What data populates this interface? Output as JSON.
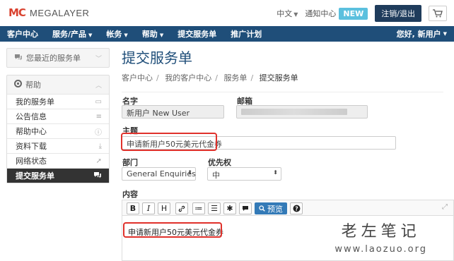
{
  "brand": {
    "name": "MEGALAYER",
    "mark": "MC"
  },
  "header": {
    "language": "中文",
    "notifications": "通知中心",
    "new_badge": "NEW",
    "logout": "注销/退出"
  },
  "nav": {
    "items": [
      {
        "label": "客户中心",
        "dropdown": false
      },
      {
        "label": "服务/产品",
        "dropdown": true
      },
      {
        "label": "帐务",
        "dropdown": true
      },
      {
        "label": "帮助",
        "dropdown": true
      },
      {
        "label": "提交服务单",
        "dropdown": false
      },
      {
        "label": "推广计划",
        "dropdown": false
      }
    ],
    "user": "您好, 新用户"
  },
  "sidebar": {
    "recent_title": "您最近的服务单",
    "help_title": "帮助",
    "items": [
      {
        "label": "我的服务单",
        "icon": "ticket-icon"
      },
      {
        "label": "公告信息",
        "icon": "list-icon"
      },
      {
        "label": "帮助中心",
        "icon": "info-icon"
      },
      {
        "label": "资料下载",
        "icon": "download-icon"
      },
      {
        "label": "网络状态",
        "icon": "rocket-icon"
      },
      {
        "label": "提交服务单",
        "icon": "comments-icon",
        "active": true
      }
    ]
  },
  "main": {
    "title": "提交服务单",
    "breadcrumb": [
      "客户中心",
      "我的客户中心",
      "服务单",
      "提交服务单"
    ],
    "form": {
      "name_label": "名字",
      "name_value": "新用户 New User",
      "email_label": "邮箱",
      "subject_label": "主题",
      "subject_value": "申请新用户50元美元代金券",
      "dept_label": "部门",
      "dept_value": "General Enquiries",
      "priority_label": "优先权",
      "priority_value": "中",
      "content_label": "内容",
      "preview_label": "预览",
      "content_value": "申请新用户50元美元代金券"
    }
  },
  "watermark": {
    "title": "老左笔记",
    "url": "www.laozuo.org"
  },
  "colors": {
    "nav": "#1f4e79",
    "highlight": "#e0312b",
    "brand": "#d9422f",
    "new_badge": "#5bc0de"
  }
}
